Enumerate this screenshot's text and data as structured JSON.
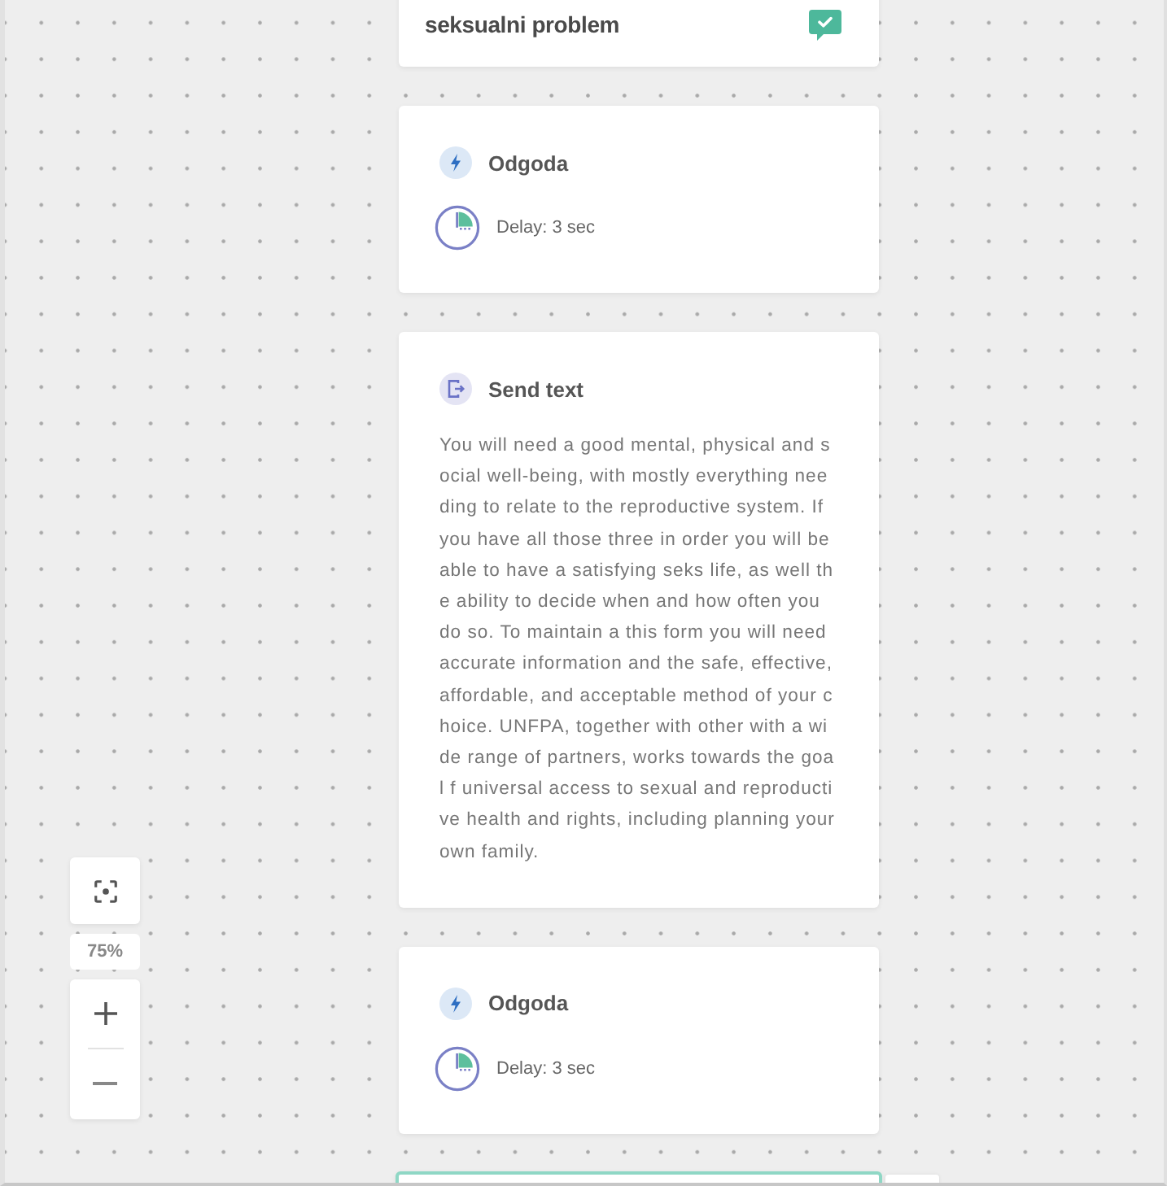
{
  "canvas": {
    "nodes": [
      {
        "kind": "message",
        "title": "seksualni problem",
        "selected": false
      },
      {
        "kind": "delay",
        "title": "Odgoda",
        "detail": "Delay: 3 sec",
        "selected": false
      },
      {
        "kind": "send_text",
        "title": "Send text",
        "body": "You will need a good mental, physical and social well-being, with mostly everything needing to relate to the reproductive system. If you have all those three in order you will be able to have a satisfying seks life, as well the ability to decide when and how often you do so. To maintain a this form you will need accurate information and the safe, effective, affordable, and acceptable method of your choice. UNFPA, together with other with a wide range of partners, works towards the goal f universal access to sexual and reproductive health and rights, including planning your own family.",
        "selected": false
      },
      {
        "kind": "delay",
        "title": "Odgoda",
        "detail": "Delay: 3 sec",
        "selected": false
      },
      {
        "kind": "blank",
        "selected": true
      }
    ]
  },
  "zoom_controls": {
    "level": "75%"
  }
}
